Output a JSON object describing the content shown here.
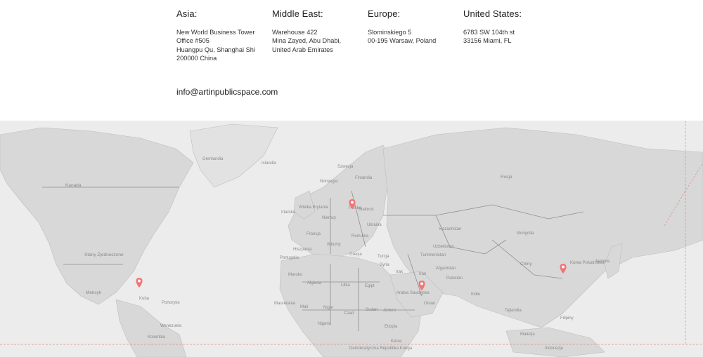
{
  "offices": [
    {
      "title": "Asia:",
      "lines": [
        "New World Business Tower",
        "Office #505",
        "Huangpu Qu, Shanghai Shi",
        "200000 China"
      ]
    },
    {
      "title": "Middle East:",
      "lines": [
        "Warehouse 422",
        "Mina Zayed, Abu Dhabi,",
        "United Arab Emirates"
      ]
    },
    {
      "title": "Europe:",
      "lines": [
        "Slominskiego 5",
        "00-195 Warsaw, Poland"
      ]
    },
    {
      "title": "United States:",
      "lines": [
        "6783 SW 104th st",
        "33156 Miami, FL"
      ]
    }
  ],
  "email": "info@artinpublicspace.com",
  "map": {
    "labels": {
      "greenland": "Grenlandia",
      "iceland": "Islandia",
      "canada": "Kanada",
      "usa": "Stany Zjednoczone",
      "mexico": "Meksyk",
      "cuba": "Kuba",
      "puerto_rico": "Portoryko",
      "venezuela": "Wenezuela",
      "colombia": "Kolumbia",
      "sweden": "Szwecja",
      "finland": "Finlandia",
      "norway": "Norwegia",
      "uk": "Wielka Brytania",
      "ireland": "Irlandia",
      "poland": "Polska",
      "germany": "Niemcy",
      "france": "Francja",
      "spain": "Hiszpania",
      "portugal": "Portugalia",
      "ukraine": "Ukraina",
      "belarus": "Bialoruś",
      "italy": "Włochy",
      "romania": "Rumunia",
      "greece": "Grecja",
      "turkey": "Turcja",
      "syria": "Syria",
      "iraq": "Irak",
      "iran": "Iran",
      "saudi": "Arabia Saudyjska",
      "oman": "Oman",
      "yemen": "Jemen",
      "morocco": "Maroko",
      "algeria": "Algieria",
      "libya": "Libia",
      "egypt": "Egipt",
      "mauritania": "Mauretania",
      "mali": "Mali",
      "niger": "Niger",
      "chad": "Czad",
      "sudan": "Sudan",
      "nigeria": "Nigeria",
      "ethiopia": "Etiopia",
      "kenya": "Kenia",
      "drc": "Demokratyczna Republika Konga",
      "russia": "Rosja",
      "kazakhstan": "Kazachstan",
      "mongolia": "Mongolia",
      "china": "Chiny",
      "turkmenistan": "Turkmenistan",
      "uzbekistan": "Uzbekistan",
      "afghanistan": "Afganistan",
      "pakistan": "Pakistan",
      "india": "Indie",
      "korea": "Korea Południowa",
      "japan": "Japonia",
      "thailand": "Tajlandia",
      "philippines": "Filipiny",
      "malaysia": "Malezja",
      "indonesia": "Indonezja"
    },
    "pin_color": "#f07474"
  }
}
